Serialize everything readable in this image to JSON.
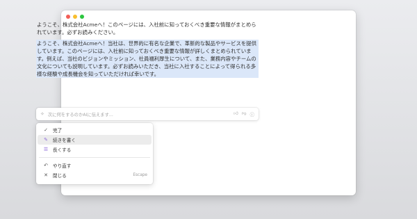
{
  "document": {
    "intro": "ようこそ、株式会社Acmeへ！このページには、入社前に知っておくべき重要な情報がまとめられています。必ずお読みください。",
    "selected": "ようこそ、株式会社Acmeへ！当社は、世界的に有名な企業で、革新的な製品やサービスを提供しています。このページには、入社前に知っておくべき重要な情報が詳しくまとめられています。例えば、当社のビジョンやミッション、社員福利厚生について、また、業務内容やチームの文化についても説明しています。必ずお読みいただき、当社に入社することによって得られる多様な経験や成長機会を知っていただければ幸いです。"
  },
  "ai_bar": {
    "placeholder": "次に何をするのかAIに伝えます...",
    "icons": [
      "thumbs-up-icon",
      "thumbs-down-icon",
      "help-icon"
    ]
  },
  "menu": {
    "items": [
      {
        "label": "完了",
        "icon": "check-icon"
      },
      {
        "label": "続きを書く",
        "icon": "pencil-icon"
      },
      {
        "label": "長くする",
        "icon": "lines-icon"
      }
    ],
    "items2": [
      {
        "label": "やり直す",
        "icon": "undo-icon"
      },
      {
        "label": "閉じる",
        "icon": "close-icon",
        "shortcut": "Escape"
      }
    ]
  },
  "colors": {
    "selection": "#dbe7f9",
    "accent": "#8e6bd8"
  }
}
